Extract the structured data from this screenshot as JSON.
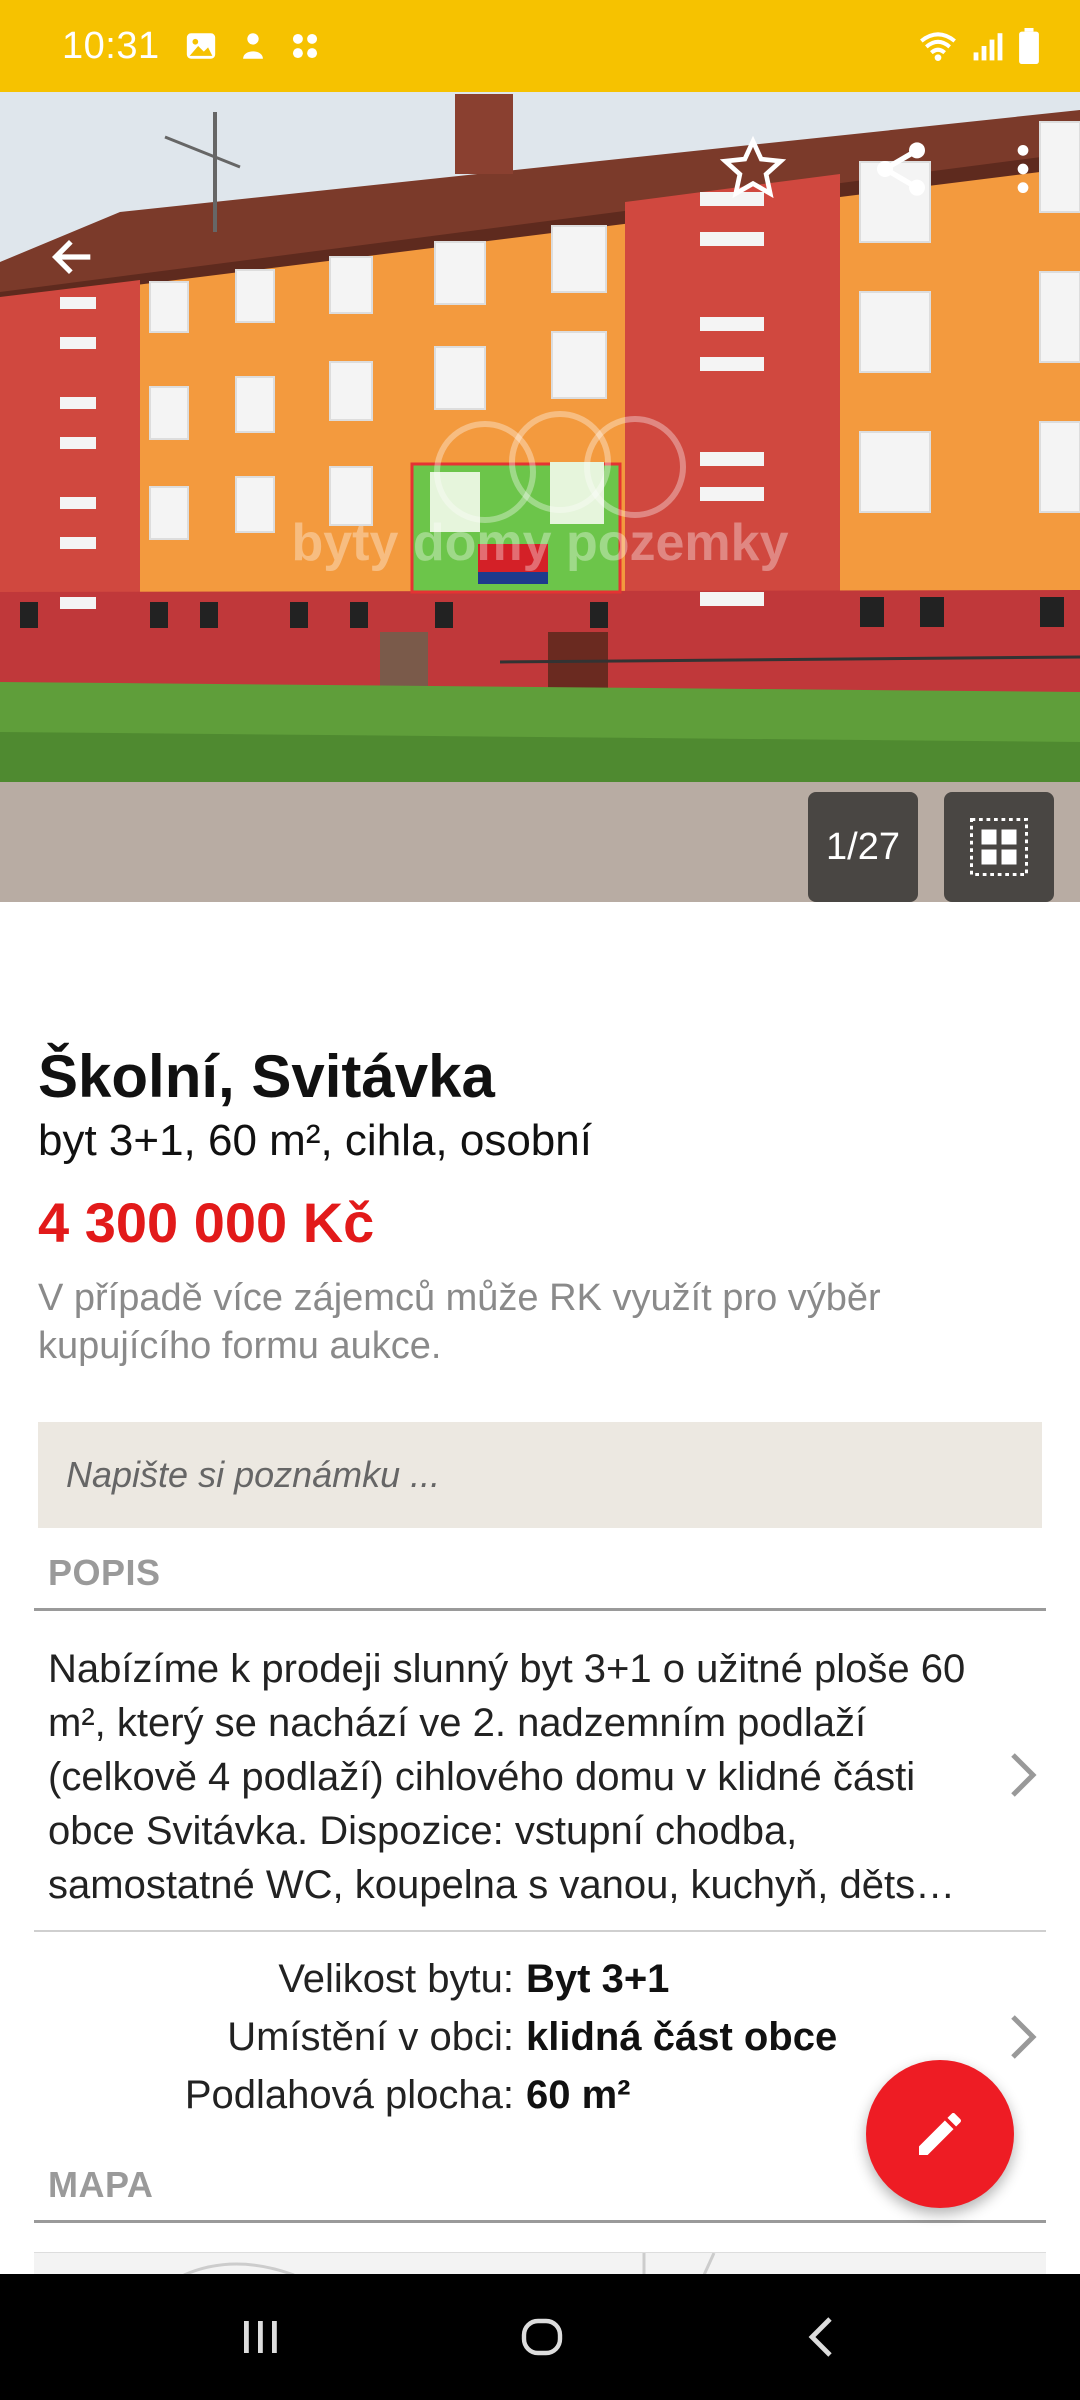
{
  "status_bar": {
    "time": "10:31"
  },
  "gallery": {
    "counter": "1/27",
    "watermark": "byty domy pozemky"
  },
  "listing": {
    "title": "Školní, Svitávka",
    "subtitle": "byt 3+1, 60 m², cihla, osobní",
    "price": "4 300 000 Kč",
    "auction_note": "V případě více zájemců může RK využít pro výběr kupujícího formu aukce."
  },
  "note_field": {
    "placeholder": "Napište si poznámku ..."
  },
  "description_section": {
    "heading": "POPIS",
    "text": "Nabízíme k prodeji slunný byt 3+1 o užitné ploše 60 m², který se nachází ve 2. nadzemním podlaží (celkově 4 podlaží) cihlového domu v klidné části obce Svitávka. Dispozice: vstupní chodba, samostatné WC, koupelna s vanou, kuchyň, děts…"
  },
  "parameters": [
    {
      "label": "Velikost bytu:",
      "value": "Byt 3+1"
    },
    {
      "label": "Umístění v obci:",
      "value": "klidná část obce"
    },
    {
      "label": "Podlahová plocha:",
      "value": "60 m²"
    }
  ],
  "map_section": {
    "heading": "MAPA"
  },
  "colors": {
    "status_bar": "#f6c200",
    "price": "#e21a1a",
    "fab": "#ee1c24",
    "note_bg": "#ece8e1"
  },
  "icons": [
    "back-arrow-icon",
    "star-icon",
    "share-icon",
    "more-vert-icon",
    "grid-icon",
    "pencil-icon",
    "recents-icon",
    "home-icon",
    "back-icon"
  ]
}
